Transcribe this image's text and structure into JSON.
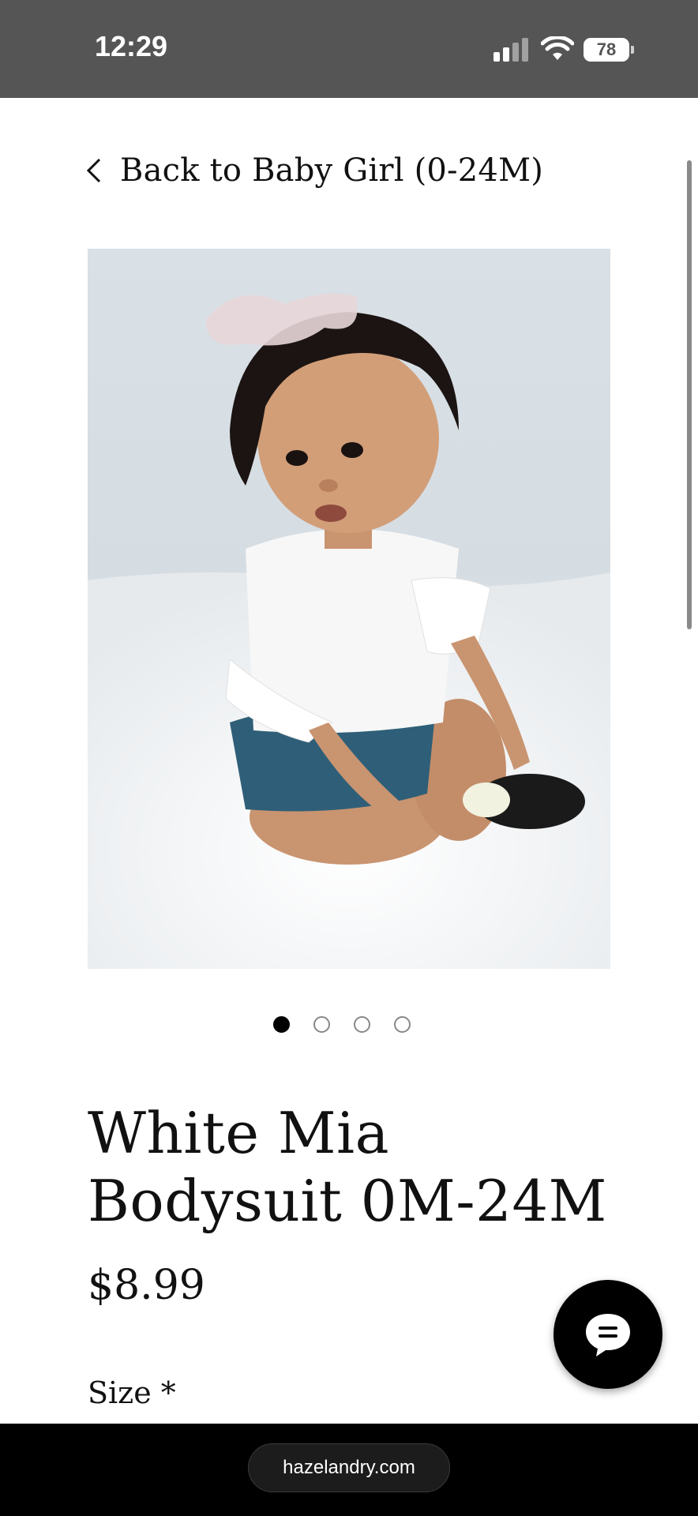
{
  "status_bar": {
    "time": "12:29",
    "battery": "78",
    "icons": [
      "signal-icon",
      "wifi-icon",
      "battery-icon"
    ]
  },
  "nav": {
    "back_label": "Back to Baby Girl (0-24M)",
    "back_icon": "chevron-left-icon"
  },
  "gallery": {
    "image_alt": "Baby girl wearing white ruffle-sleeve bodysuit and denim bloomers, sitting on white fur rug",
    "slides": 4,
    "active_index": 0
  },
  "product": {
    "title": "White Mia Bodysuit 0M-24M",
    "price": "$8.99",
    "size_label": "Size *"
  },
  "chat": {
    "icon": "chat-bubble-icon"
  },
  "browser": {
    "url": "hazelandry.com"
  },
  "colors": {
    "status_bar_bg": "#555555",
    "text": "#111111",
    "accent": "#000000"
  }
}
